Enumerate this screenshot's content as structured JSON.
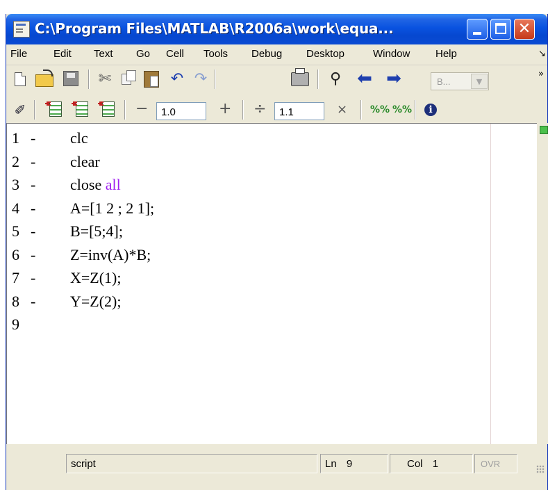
{
  "window": {
    "title": "C:\\Program Files\\MATLAB\\R2006a\\work\\equa..."
  },
  "title_buttons": {
    "close_glyph": "✕"
  },
  "menu": [
    "File",
    "Edit",
    "Text",
    "Go",
    "Cell",
    "Tools",
    "Debug",
    "Desktop",
    "Window",
    "Help"
  ],
  "toolbar": {
    "cut_glyph": "✄",
    "undo_glyph": "↶",
    "redo_glyph": "↷",
    "find_glyph": "⚲",
    "back_glyph": "⬅",
    "forward_glyph": "➡",
    "stack_combo": "B...",
    "stack_arrow": "▼",
    "more": "»"
  },
  "cell_toolbar": {
    "minus": "−",
    "plus": "+",
    "increment_value": "1.0",
    "divide": "÷",
    "times": "×",
    "multiply_value": "1.1",
    "pct_plus": "%%",
    "pct_minus": "%%",
    "info": "i"
  },
  "editor": {
    "lines": [
      {
        "num": "1",
        "dash": "-",
        "code": "clc",
        "kw": ""
      },
      {
        "num": "2",
        "dash": "-",
        "code": "clear",
        "kw": ""
      },
      {
        "num": "3",
        "dash": "-",
        "code": "close ",
        "kw": "all"
      },
      {
        "num": "4",
        "dash": "-",
        "code": "A=[1 2 ; 2 1];",
        "kw": ""
      },
      {
        "num": "5",
        "dash": "-",
        "code": "B=[5;4];",
        "kw": ""
      },
      {
        "num": "6",
        "dash": "-",
        "code": "Z=inv(A)*B;",
        "kw": ""
      },
      {
        "num": "7",
        "dash": "-",
        "code": "X=Z(1);",
        "kw": ""
      },
      {
        "num": "8",
        "dash": "-",
        "code": "Y=Z(2);",
        "kw": ""
      },
      {
        "num": "9",
        "dash": "",
        "code": "",
        "kw": ""
      }
    ]
  },
  "status": {
    "mode": "script",
    "ln_label": "Ln",
    "ln_value": "9",
    "col_label": "Col",
    "col_value": "1",
    "ovr": "OVR"
  },
  "colors": {
    "keyword": "#a020f0",
    "titlebar": "#0a53e0"
  }
}
